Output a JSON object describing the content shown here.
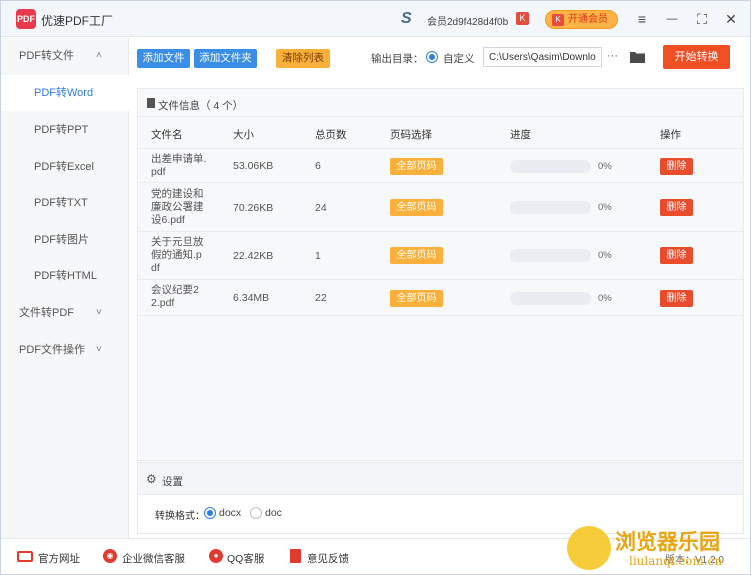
{
  "app": {
    "logo_text": "PDF",
    "title": "优速PDF工厂",
    "member_id": "会员2d9f428d4f0b",
    "vip_button": "开通会员",
    "vip_k": "K"
  },
  "window_controls": {
    "menu": "≡",
    "minimize": "—",
    "maximize": "⛶",
    "close": "✕"
  },
  "sidebar": {
    "items": [
      {
        "label": "PDF转文件",
        "chevron": "˄",
        "type": "group"
      },
      {
        "label": "PDF转Word",
        "type": "sub",
        "active": true
      },
      {
        "label": "PDF转PPT",
        "type": "sub"
      },
      {
        "label": "PDF转Excel",
        "type": "sub"
      },
      {
        "label": "PDF转TXT",
        "type": "sub"
      },
      {
        "label": "PDF转图片",
        "type": "sub"
      },
      {
        "label": "PDF转HTML",
        "type": "sub"
      },
      {
        "label": "文件转PDF",
        "chevron": "˅",
        "type": "group"
      },
      {
        "label": "PDF文件操作",
        "chevron": "˅",
        "type": "group"
      }
    ]
  },
  "toolbar": {
    "add_file": "添加文件",
    "add_folder": "添加文件夹",
    "clear_list": "清除列表",
    "output_label": "输出目录：",
    "custom_label": "自定义",
    "path_value": "C:\\Users\\Qasim\\Downlo",
    "more": "···",
    "start": "开始转换"
  },
  "file_panel": {
    "title": "文件信息（ 4 个）",
    "columns": [
      "文件名",
      "大小",
      "总页数",
      "页码选择",
      "进度",
      "操作"
    ],
    "rows": [
      {
        "name_lines": [
          "出差申请单.",
          "pdf"
        ],
        "size": "53.06KB",
        "pages": "6",
        "page_select": "全部页码",
        "progress": 0,
        "progress_label": "0%",
        "action": "删除"
      },
      {
        "name_lines": [
          "党的建设和",
          "廉政公署建",
          "设6.pdf"
        ],
        "size": "70.26KB",
        "pages": "24",
        "page_select": "全部页码",
        "progress": 0,
        "progress_label": "0%",
        "action": "删除"
      },
      {
        "name_lines": [
          "关于元旦放",
          "假的通知.p",
          "df"
        ],
        "size": "22.42KB",
        "pages": "1",
        "page_select": "全部页码",
        "progress": 0,
        "progress_label": "0%",
        "action": "删除"
      },
      {
        "name_lines": [
          "会议纪要2",
          "2.pdf"
        ],
        "size": "6.34MB",
        "pages": "22",
        "page_select": "全部页码",
        "progress": 0,
        "progress_label": "0%",
        "action": "删除"
      }
    ]
  },
  "settings": {
    "title": "设置",
    "format_label": "转换格式：",
    "options": [
      {
        "label": "docx",
        "selected": true
      },
      {
        "label": "doc",
        "selected": false
      }
    ]
  },
  "footer": {
    "links": [
      "官方网址",
      "企业微信客服",
      "QQ客服",
      "意见反馈"
    ],
    "version": "版本：V1.2.0"
  },
  "watermark": {
    "text": "浏览器乐园",
    "sub": "liulanqi.com.cn"
  },
  "colors": {
    "accent_blue": "#3a8ee6",
    "orange": "#fbb03b",
    "start_red": "#f04e23",
    "delete_red": "#e84c2b"
  }
}
